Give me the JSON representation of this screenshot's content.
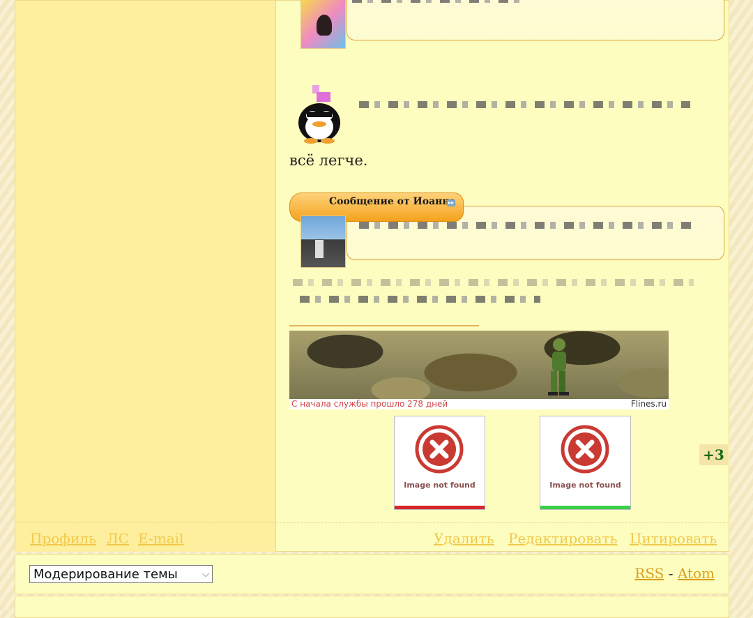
{
  "post": {
    "text_line": "всё легче.",
    "quote_header": "Сообщение от Иоанна",
    "banner": {
      "caption": "С начала службы прошло 278 дней",
      "site": "Flines.ru"
    },
    "broken_images": [
      {
        "text": "Image not found",
        "bar_color": "#d9262b"
      },
      {
        "text": "Image not found",
        "bar_color": "#3ad14a"
      }
    ],
    "rating": "+3",
    "left_links": {
      "profile": "Профиль",
      "pm": "ЛС",
      "email": "E-mail"
    },
    "actions": {
      "delete": "Удалить",
      "edit": "Редактировать",
      "quote": "Цитировать"
    }
  },
  "moderation": {
    "select_value": "Модерирование темы",
    "rss": "RSS",
    "separator": "-",
    "atom": "Atom"
  }
}
